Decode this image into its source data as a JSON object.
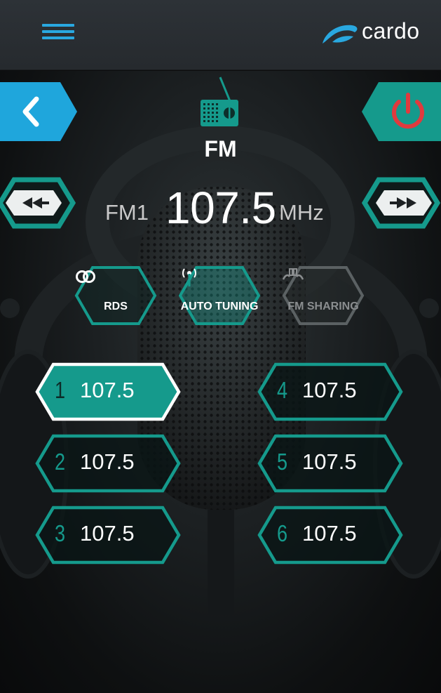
{
  "header": {
    "brand": "cardo",
    "menu_icon": "hamburger-menu-icon",
    "accent_color": "#29a8e0"
  },
  "radio": {
    "mode_title": "FM",
    "band": "FM1",
    "frequency": "107.5",
    "unit": "MHz",
    "mode_icon": "radio-icon"
  },
  "controls": {
    "back_icon": "chevron-left-icon",
    "power_icon": "power-icon",
    "seek_back_icon": "rewind-icon",
    "seek_forward_icon": "fast-forward-icon"
  },
  "functions": [
    {
      "label": "RDS",
      "icon": "rds-icon",
      "enabled": true
    },
    {
      "label": "AUTO TUNING",
      "icon": "antenna-icon",
      "enabled": true
    },
    {
      "label": "FM SHARING",
      "icon": "fm-sharing-icon",
      "enabled": false
    }
  ],
  "presets": [
    {
      "number": "1",
      "frequency": "107.5",
      "selected": true
    },
    {
      "number": "2",
      "frequency": "107.5",
      "selected": false
    },
    {
      "number": "3",
      "frequency": "107.5",
      "selected": false
    },
    {
      "number": "4",
      "frequency": "107.5",
      "selected": false
    },
    {
      "number": "5",
      "frequency": "107.5",
      "selected": false
    },
    {
      "number": "6",
      "frequency": "107.5",
      "selected": false
    }
  ],
  "colors": {
    "teal": "#159a8c",
    "blue": "#29a8e0",
    "power_red": "#e03a3e",
    "background": "#0c0d0e"
  }
}
